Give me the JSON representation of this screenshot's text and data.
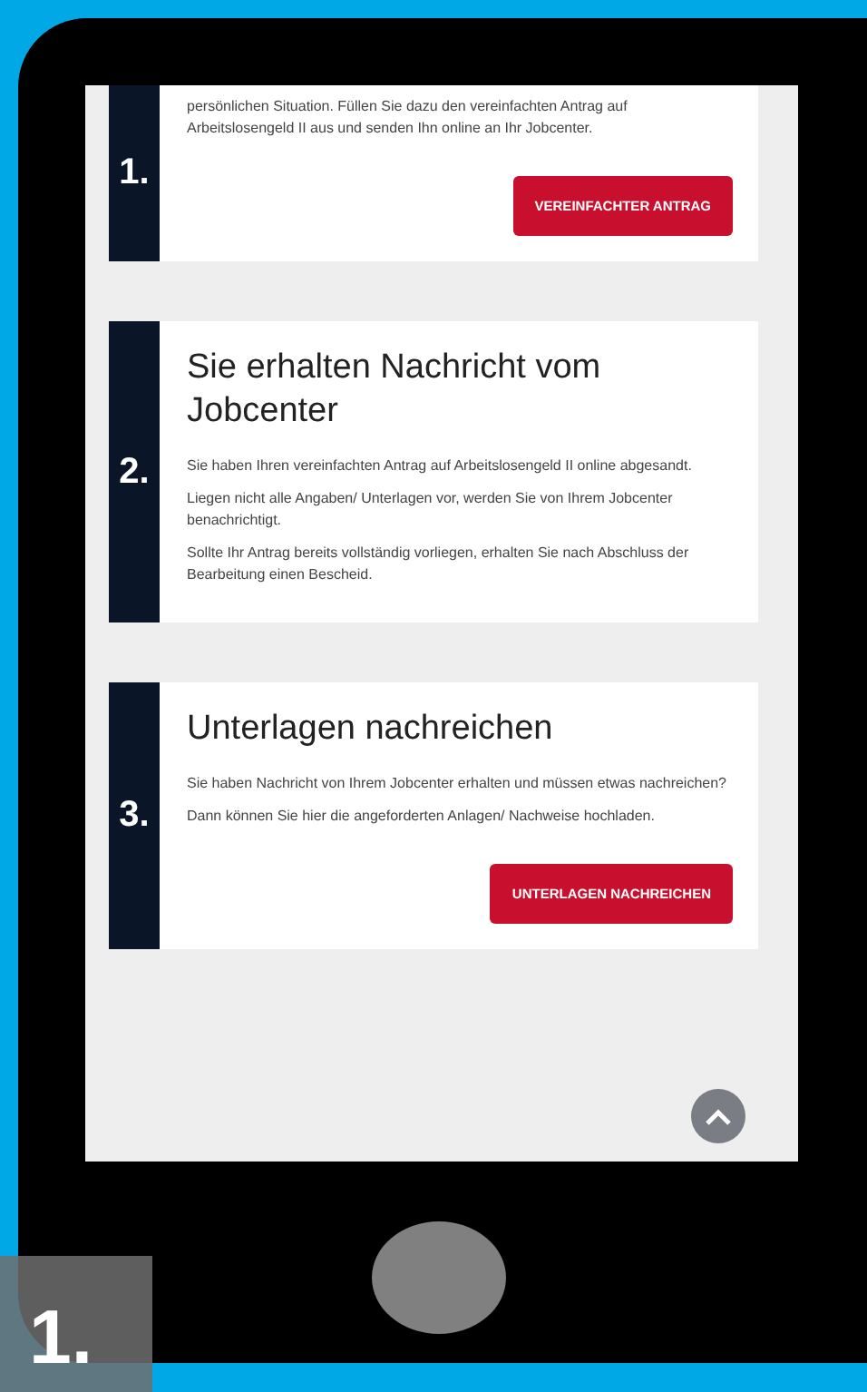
{
  "steps": [
    {
      "number": "1.",
      "paragraphs": [
        "persönlichen Situation. Füllen Sie dazu den vereinfachten Antrag auf Arbeitslosengeld II aus und senden Ihn online an Ihr Jobcenter."
      ],
      "button": "VEREINFACHTER ANTRAG"
    },
    {
      "number": "2.",
      "title": "Sie erhalten Nachricht vom Jobcenter",
      "paragraphs": [
        "Sie haben Ihren vereinfachten Antrag auf Arbeitslosengeld II online abgesandt.",
        "Liegen nicht alle Angaben/ Unterlagen vor, werden Sie von Ihrem Jobcenter benachrichtigt.",
        "Sollte Ihr Antrag bereits vollständig vorliegen, erhalten Sie nach Abschluss der Bearbeitung einen Bescheid."
      ]
    },
    {
      "number": "3.",
      "title": "Unterlagen nachreichen",
      "paragraphs": [
        "Sie haben Nachricht von Ihrem Jobcenter erhalten und müssen etwas nachreichen?",
        "Dann können Sie hier die angeforderten Anlagen/ Nachweise hochladen."
      ],
      "button": "UNTERLAGEN NACHREICHEN"
    }
  ],
  "slide_label": "1."
}
